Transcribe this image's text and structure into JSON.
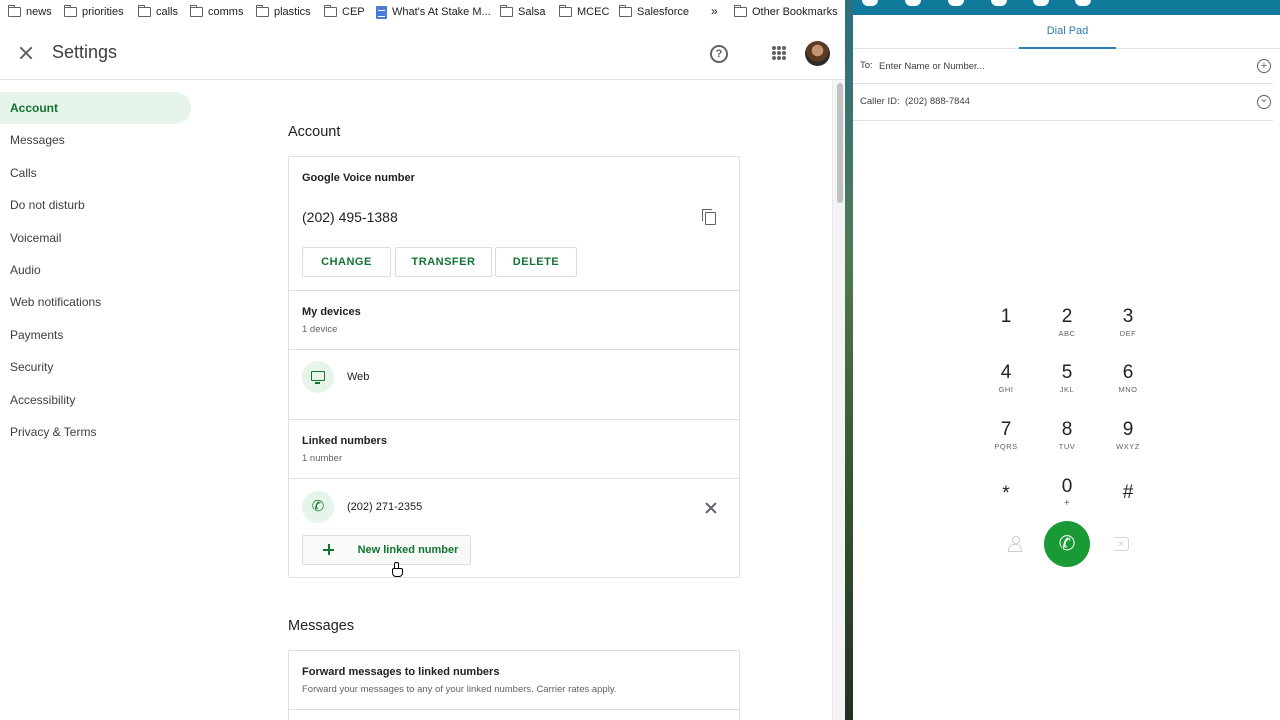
{
  "bookmarks": {
    "items": [
      {
        "label": "news",
        "icon": "folder-icon"
      },
      {
        "label": "priorities",
        "icon": "folder-icon"
      },
      {
        "label": "calls",
        "icon": "folder-icon"
      },
      {
        "label": "comms",
        "icon": "folder-icon"
      },
      {
        "label": "plastics",
        "icon": "folder-icon"
      },
      {
        "label": "CEP",
        "icon": "folder-icon"
      },
      {
        "label": "What's At Stake M...",
        "icon": "doc-icon"
      },
      {
        "label": "Salsa",
        "icon": "folder-icon"
      },
      {
        "label": "MCEC",
        "icon": "folder-icon"
      },
      {
        "label": "Salesforce",
        "icon": "folder-icon"
      }
    ],
    "overflow": "»",
    "other": "Other Bookmarks"
  },
  "header": {
    "title": "Settings",
    "help_glyph": "?"
  },
  "sidebar": {
    "items": [
      {
        "label": "Account",
        "active": true
      },
      {
        "label": "Messages"
      },
      {
        "label": "Calls"
      },
      {
        "label": "Do not disturb"
      },
      {
        "label": "Voicemail"
      },
      {
        "label": "Audio"
      },
      {
        "label": "Web notifications"
      },
      {
        "label": "Payments"
      },
      {
        "label": "Security"
      },
      {
        "label": "Accessibility"
      },
      {
        "label": "Privacy & Terms"
      }
    ]
  },
  "account": {
    "section_title": "Account",
    "gv_title": "Google Voice number",
    "gv_number": "(202) 495-1388",
    "change_label": "CHANGE",
    "transfer_label": "TRANSFER",
    "delete_label": "DELETE",
    "devices_title": "My devices",
    "devices_count": "1 device",
    "device_name": "Web",
    "linked_title": "Linked numbers",
    "linked_count": "1 number",
    "linked_number": "(202) 271-2355",
    "new_linked_label": "New linked number"
  },
  "messages": {
    "section_title": "Messages",
    "forward_title": "Forward messages to linked numbers",
    "forward_desc": "Forward your messages to any of your linked numbers. Carrier rates apply."
  },
  "dialer": {
    "tab_label": "Dial Pad",
    "to_label": "To:",
    "to_placeholder": "Enter Name or Number...",
    "add_glyph": "+",
    "caller_id_label": "Caller ID:",
    "caller_id_value": "(202) 888-7844",
    "expand_glyph": "⌄",
    "keys": [
      {
        "digit": "1",
        "letters": ""
      },
      {
        "digit": "2",
        "letters": "ABC"
      },
      {
        "digit": "3",
        "letters": "DEF"
      },
      {
        "digit": "4",
        "letters": "GHI"
      },
      {
        "digit": "5",
        "letters": "JKL"
      },
      {
        "digit": "6",
        "letters": "MNO"
      },
      {
        "digit": "7",
        "letters": "PQRS"
      },
      {
        "digit": "8",
        "letters": "TUV"
      },
      {
        "digit": "9",
        "letters": "WXYZ"
      },
      {
        "digit": "*",
        "letters": ""
      },
      {
        "digit": "0",
        "letters": "+"
      },
      {
        "digit": "#",
        "letters": ""
      }
    ],
    "call_glyph": "✆",
    "accent_color": "#1a9a35",
    "topbar_color": "#0f7a99"
  },
  "colors": {
    "active_nav_bg": "#e6f4ea",
    "accent_green": "#137333"
  }
}
